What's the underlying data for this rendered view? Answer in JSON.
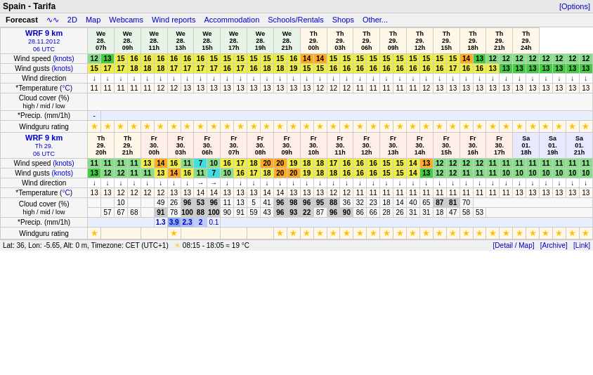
{
  "title": "Spain - Tarifa",
  "options_label": "[Options]",
  "nav": {
    "items": [
      {
        "label": "Forecast",
        "active": true
      },
      {
        "label": "∿∿"
      },
      {
        "label": "2D"
      },
      {
        "label": "Map"
      },
      {
        "label": "Webcams"
      },
      {
        "label": "Wind reports"
      },
      {
        "label": "Accommodation"
      },
      {
        "label": "Schools/Rentals"
      },
      {
        "label": "Shops"
      },
      {
        "label": "Other..."
      }
    ]
  },
  "bottom_bar": {
    "left": "Lat: 36, Lon: -5.65, Alt: 0 m, Timezone: CET (UTC+1)  ☀ 08:15 - 18:05 ≈ 19 °C",
    "right": "[Detail / Map]  [Archive]  [Link]"
  },
  "model1": {
    "title": "WRF 9 km",
    "subtitle": "28.11.2012",
    "utc": "06 UTC"
  },
  "model2": {
    "title": "WRF 9 km",
    "subtitle": "Th 29.",
    "utc": "06 UTC"
  }
}
